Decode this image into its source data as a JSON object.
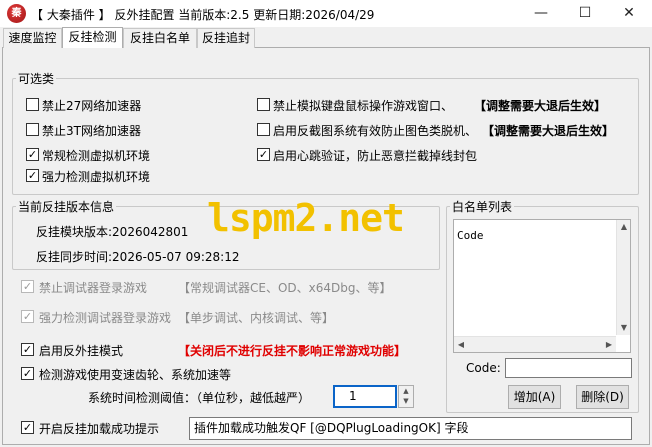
{
  "window": {
    "title": "【 大秦插件 】 反外挂配置 当前版本:2.5 更新日期:2026/04/29",
    "logo_char": "秦",
    "minimize_glyph": "—",
    "maximize_glyph": "☐",
    "close_glyph": "✕"
  },
  "tabs": [
    {
      "label": "速度监控",
      "active": false
    },
    {
      "label": "反挂检测",
      "active": true
    },
    {
      "label": "反挂白名单",
      "active": false
    },
    {
      "label": "反挂追封",
      "active": false
    }
  ],
  "optional_group": {
    "title": "可选类",
    "items": [
      {
        "label": "禁止27网络加速器",
        "checked": false
      },
      {
        "label": "禁止3T网络加速器",
        "checked": false
      },
      {
        "label": "常规检测虚拟机环境",
        "checked": true
      },
      {
        "label": "强力检测虚拟机环境",
        "checked": true
      },
      {
        "label": "禁止模拟键盘鼠标操作游戏窗口、",
        "checked": false,
        "note": "【调整需要大退后生效】"
      },
      {
        "label": "启用反截图系统有效防止图色类脱机、",
        "checked": false,
        "note": "【调整需要大退后生效】"
      },
      {
        "label": "启用心跳验证，防止恶意拦截掉线封包",
        "checked": true
      }
    ]
  },
  "version_group": {
    "title": "当前反挂版本信息",
    "module_version": "反挂模块版本:2026042801",
    "sync_time": "反挂同步时间:2026-05-07 09:28:12"
  },
  "debugger_rows": [
    {
      "label": "禁止调试器登录游戏",
      "note": "【常规调试器CE、OD、x64Dbg、等】",
      "checked": true,
      "disabled": true
    },
    {
      "label": "强力检测调试器登录游戏",
      "note": "【单步调试、内核调试、等】",
      "checked": true,
      "disabled": true
    }
  ],
  "anticheat_mode": {
    "label": "启用反外挂模式",
    "note": "【关闭后不进行反挂不影响正常游戏功能】",
    "checked": true
  },
  "speed_detect": {
    "label": "检测游戏使用变速齿轮、系统加速等",
    "checked": true
  },
  "interval": {
    "label": "系统时间检测阈值：（单位秒，越低越严）",
    "value": "1"
  },
  "load_prompt": {
    "label": "开启反挂加载成功提示",
    "checked": true,
    "message": "插件加载成功触发QF [@DQPlugLoadingOK] 字段"
  },
  "whitelist": {
    "title": "白名单列表",
    "header": "Code",
    "code_label": "Code:",
    "code_value": "",
    "add_button": "增加(A)",
    "delete_button": "删除(D)"
  },
  "watermark": "lspm2.net",
  "check_glyph": "✓"
}
